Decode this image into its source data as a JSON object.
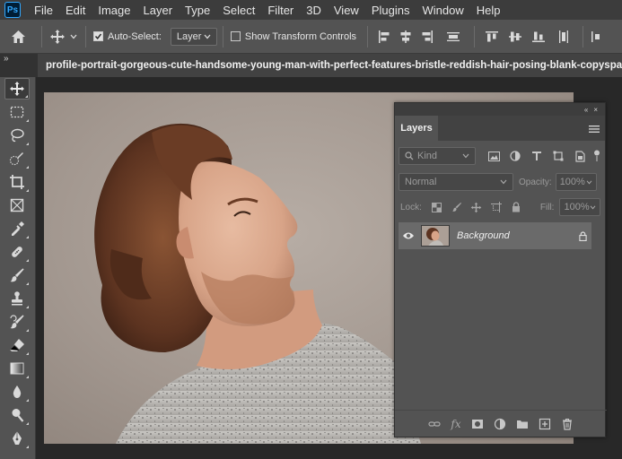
{
  "app": {
    "logo_text": "Ps"
  },
  "menu": [
    "File",
    "Edit",
    "Image",
    "Layer",
    "Type",
    "Select",
    "Filter",
    "3D",
    "View",
    "Plugins",
    "Window",
    "Help"
  ],
  "options_bar": {
    "auto_select_label": "Auto-Select:",
    "auto_select_checked": true,
    "auto_select_target": "Layer",
    "show_transform_label": "Show Transform Controls",
    "show_transform_checked": false
  },
  "tab_strip": {
    "collapse_glyph": "»",
    "document_title": "profile-portrait-gorgeous-cute-handsome-young-man-with-perfect-features-bristle-reddish-hair-posing-blank-copyspace-w"
  },
  "toolbar": {
    "tools": [
      "move-tool",
      "rectangular-marquee-tool",
      "lasso-tool",
      "quick-selection-tool",
      "crop-tool",
      "frame-tool",
      "eyedropper-tool",
      "spot-healing-brush-tool",
      "brush-tool",
      "clone-stamp-tool",
      "history-brush-tool",
      "eraser-tool",
      "gradient-tool",
      "blur-tool",
      "dodge-tool",
      "pen-tool"
    ],
    "active_tool": "move-tool"
  },
  "layers_panel": {
    "collapse_glyph": "«",
    "close_glyph": "×",
    "tab_label": "Layers",
    "filter_kind": "Kind",
    "blend_mode": "Normal",
    "opacity_label": "Opacity:",
    "opacity_value": "100%",
    "lock_label": "Lock:",
    "fill_label": "Fill:",
    "fill_value": "100%",
    "layers": [
      {
        "name": "Background",
        "visible": true,
        "locked": true
      }
    ],
    "bottom_fx_label": "fx"
  },
  "colors": {
    "menubar_bg": "#3c3c3c",
    "panel_bg": "#535353",
    "canvas_bg": "#282828",
    "accent": "#31a8ff"
  }
}
